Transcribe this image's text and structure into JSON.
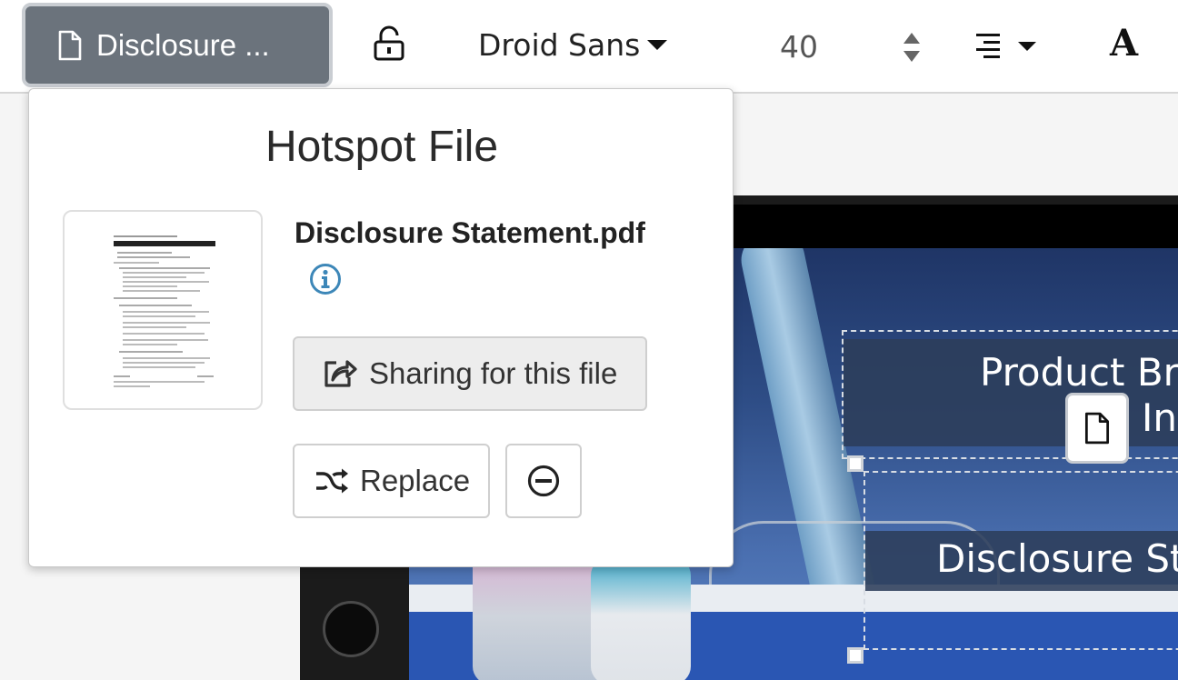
{
  "toolbar": {
    "file_button_label": "Disclosure ...",
    "font_family": "Droid Sans",
    "font_size": "40",
    "text_style_glyph": "A",
    "icons": {
      "file": "file-icon",
      "lock": "lock-icon",
      "stepper": "stepper-icon",
      "align": "align-right-icon"
    }
  },
  "popover": {
    "title": "Hotspot File",
    "file_name": "Disclosure Statement.pdf",
    "share_label": "Sharing for this file",
    "replace_label": "Replace",
    "icons": {
      "info": "info-icon",
      "share": "share-icon",
      "replace": "shuffle-icon",
      "remove": "minus-circle-icon"
    }
  },
  "canvas": {
    "banner1_line1": "Product Bro",
    "banner1_line2": "In",
    "banner2_line1": "Disclosure Sta"
  },
  "colors": {
    "file_button_bg": "#6b737c",
    "banner_bg": "#2c3e5a",
    "info_icon": "#3d87b8"
  }
}
